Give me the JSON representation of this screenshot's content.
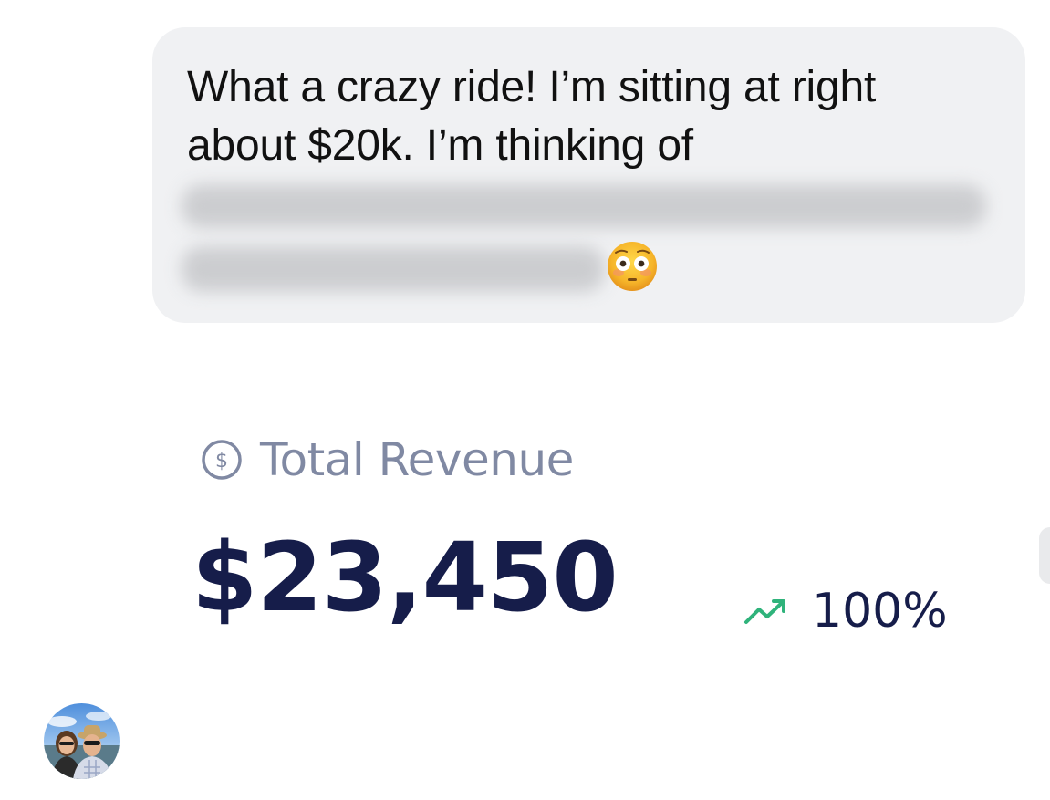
{
  "message": {
    "text_line1": "What a crazy ride! I’m sitting at right",
    "text_line2": "about $20k. I’m thinking of",
    "emoji": "flushed-face",
    "bubble_color": "#f0f1f3"
  },
  "revenue_card": {
    "title": "Total Revenue",
    "value": "$23,450",
    "change_percent": "100%",
    "trend": "up",
    "colors": {
      "title": "#8089a3",
      "value": "#161d4a",
      "trend_icon": "#2fb37b"
    }
  },
  "sender": {
    "avatar": "user-avatar-photo"
  }
}
